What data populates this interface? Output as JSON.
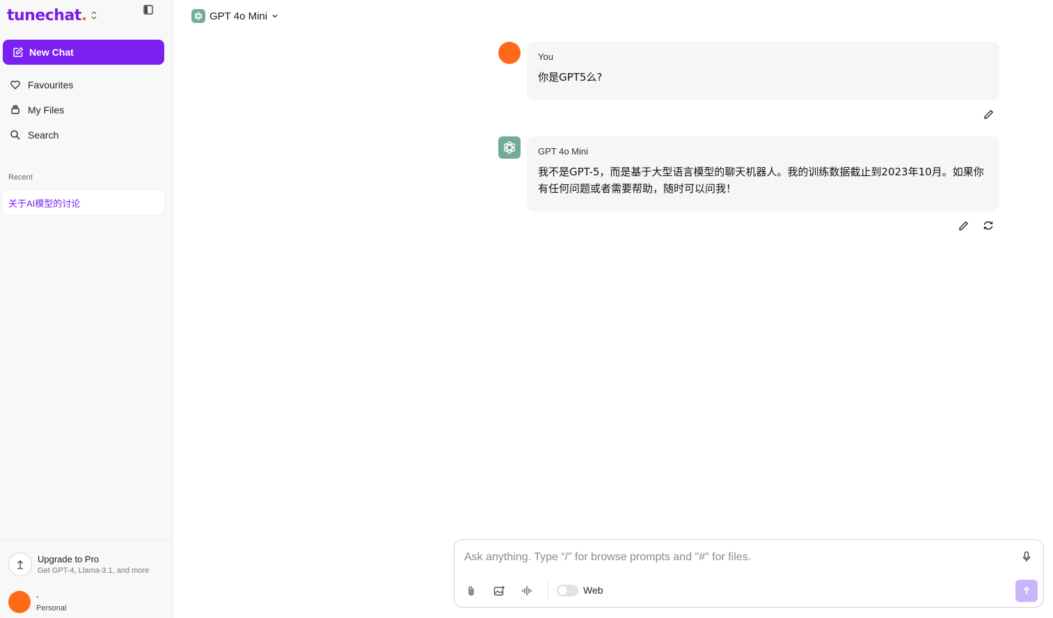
{
  "brand": {
    "name": "tunechat",
    "dot": ".",
    "primary_color": "#7a20f0",
    "accent_color": "#ff6a13"
  },
  "sidebar": {
    "new_chat_label": "New Chat",
    "nav": [
      {
        "label": "Favourites",
        "icon": "heart-icon"
      },
      {
        "label": "My Files",
        "icon": "files-icon"
      },
      {
        "label": "Search",
        "icon": "search-icon"
      }
    ],
    "recent_label": "Recent",
    "recent_items": [
      "关于AI模型的讨论"
    ],
    "upgrade": {
      "title": "Upgrade to Pro",
      "subtitle": "Get GPT-4, Llama-3.1, and more"
    },
    "user": {
      "name": "-",
      "plan": "Personal"
    }
  },
  "header": {
    "model_name": "GPT 4o Mini"
  },
  "messages": [
    {
      "sender": "You",
      "text": "你是GPT5么?"
    },
    {
      "sender": "GPT 4o Mini",
      "text": "我不是GPT-5，而是基于大型语言模型的聊天机器人。我的训练数据截止到2023年10月。如果你有任何问题或者需要帮助，随时可以问我！"
    }
  ],
  "composer": {
    "placeholder": "Ask anything. Type “/” for browse prompts and \"#\" for files.",
    "web_label": "Web"
  }
}
